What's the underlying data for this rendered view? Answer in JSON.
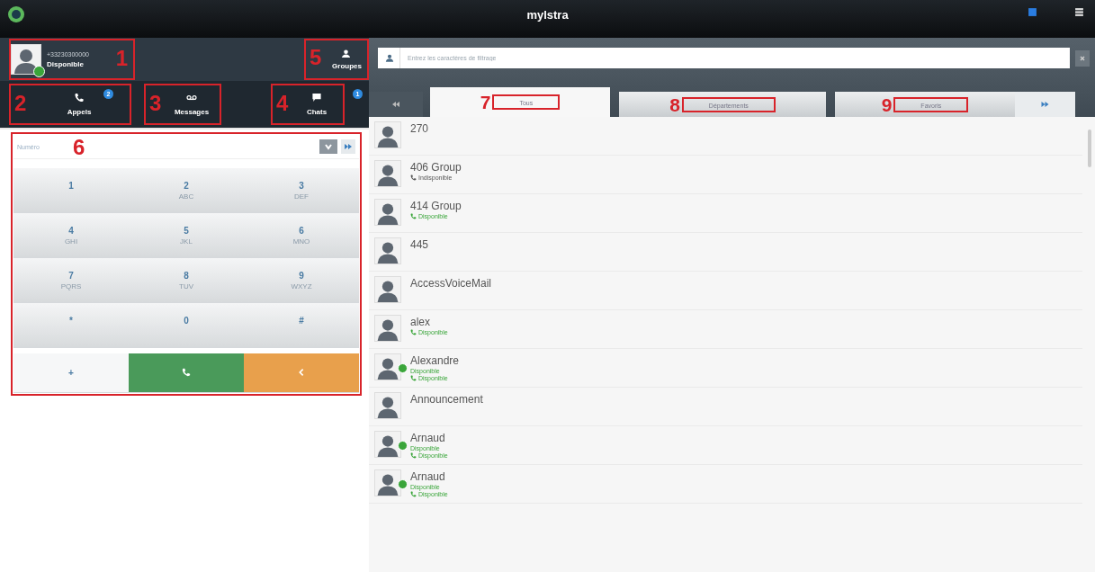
{
  "window": {
    "title": "mylstra"
  },
  "profile": {
    "number": "+33230300000",
    "status": "Disponible",
    "online": true,
    "callout": "1"
  },
  "groups_button": {
    "label": "Groupes",
    "callout": "5"
  },
  "nav_tabs": [
    {
      "label": "Appels",
      "badge": "2",
      "callout": "2"
    },
    {
      "label": "Messages",
      "callout": "3"
    },
    {
      "label": "Chats",
      "badge": "1",
      "callout": "4"
    }
  ],
  "dialpad": {
    "callout": "6",
    "placeholder": "Numéro",
    "keys": [
      {
        "digit": "1"
      },
      {
        "digit": "2",
        "letters": "ABC"
      },
      {
        "digit": "3",
        "letters": "DEF"
      },
      {
        "digit": "4",
        "letters": "GHI"
      },
      {
        "digit": "5",
        "letters": "JKL"
      },
      {
        "digit": "6",
        "letters": "MNO"
      },
      {
        "digit": "7",
        "letters": "PQRS"
      },
      {
        "digit": "8",
        "letters": "TUV"
      },
      {
        "digit": "9",
        "letters": "WXYZ"
      },
      {
        "digit": "*"
      },
      {
        "digit": "0"
      },
      {
        "digit": "#"
      }
    ],
    "actions": [
      {
        "kind": "plus",
        "label": "+"
      },
      {
        "kind": "call"
      },
      {
        "kind": "back"
      }
    ]
  },
  "search": {
    "placeholder": "Entrez les caractères de filtrage"
  },
  "directory_tabs": [
    {
      "label": "Tous",
      "selected": true,
      "callout": "7"
    },
    {
      "label": "Départements",
      "selected": false,
      "callout": "8"
    },
    {
      "label": "Favoris",
      "selected": false,
      "callout": "9"
    }
  ],
  "contacts": [
    {
      "name": "270",
      "online": false
    },
    {
      "name": "406 Group",
      "online": false,
      "phone": {
        "text": "Indisponible",
        "available": false
      }
    },
    {
      "name": "414 Group",
      "online": false,
      "phone": {
        "text": "Disponible",
        "available": true
      }
    },
    {
      "name": "445",
      "online": false
    },
    {
      "name": "AccessVoiceMail",
      "online": false
    },
    {
      "name": "alex",
      "online": false,
      "phone": {
        "text": "Disponible",
        "available": true
      }
    },
    {
      "name": "Alexandre",
      "online": true,
      "presence": "Disponible",
      "phone": {
        "text": "Disponible",
        "available": true
      }
    },
    {
      "name": "Announcement",
      "online": false
    },
    {
      "name": "Arnaud",
      "online": true,
      "presence": "Disponible",
      "phone": {
        "text": "Disponible",
        "available": true
      }
    },
    {
      "name": "Arnaud",
      "online": true,
      "presence": "Disponible",
      "phone": {
        "text": "Disponible",
        "available": true
      }
    }
  ]
}
